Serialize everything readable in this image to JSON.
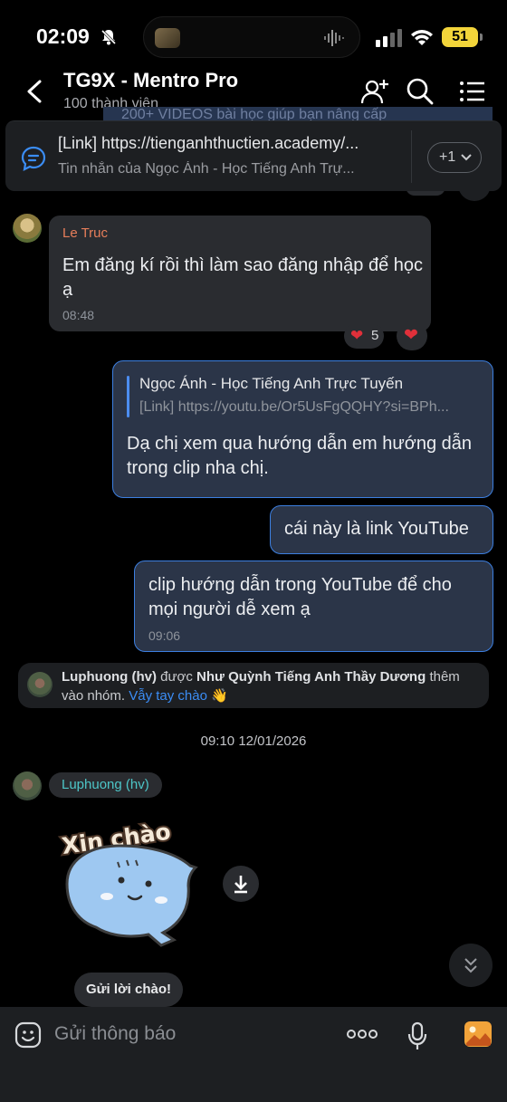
{
  "status_bar": {
    "time": "02:09",
    "battery": "51"
  },
  "header": {
    "title": "TG9X - Mentro Pro",
    "subtitle": "100 thành viên"
  },
  "pinned": {
    "line1": "[Link] https://tienganhthuctien.academy/...",
    "line2": "Tin nhắn của Ngọc Ánh - Học Tiếng Anh Trự...",
    "more_label": "+1"
  },
  "ghost_text": "200+ VIDEOS bài học giúp bạn nâng cấp",
  "messages": {
    "m1": {
      "sender": "Le Truc",
      "text": "Em đăng kí rồi thì làm sao đăng nhập để học ạ",
      "time": "08:48",
      "reaction_count": "5"
    },
    "m2": {
      "quote_author": "Ngọc Ánh - Học Tiếng Anh Trực Tuyến",
      "quote_text": "[Link] https://youtu.be/Or5UsFgQQHY?si=BPh...",
      "text": "Dạ chị xem qua hướng dẫn em hướng dẫn trong clip nha chị."
    },
    "m3": {
      "text": "cái này là link YouTube"
    },
    "m4": {
      "text": "clip hướng dẫn trong YouTube để cho mọi người dễ xem ạ",
      "time": "09:06"
    }
  },
  "system_notice": {
    "member": "Luphuong (hv)",
    "verb": "được",
    "by": "Như Quỳnh Tiếng Anh Thầy Dương",
    "action": "thêm vào nhóm.",
    "link": "Vẫy tay chào",
    "emoji": "👋"
  },
  "date_divider": "09:10 12/01/2026",
  "sticker_msg": {
    "sender": "Luphuong (hv)",
    "sticker_text": "Xin chào"
  },
  "greet_button": "Gửi lời chào!",
  "composer": {
    "placeholder": "Gửi thông báo",
    "more": "ooo"
  },
  "colors": {
    "accent": "#3c7fe0",
    "outgoing_bg": "#2b3548",
    "incoming_bg": "#2a2c30",
    "sender_name": "#e77e5a",
    "new_member_name": "#4dc6c8"
  }
}
